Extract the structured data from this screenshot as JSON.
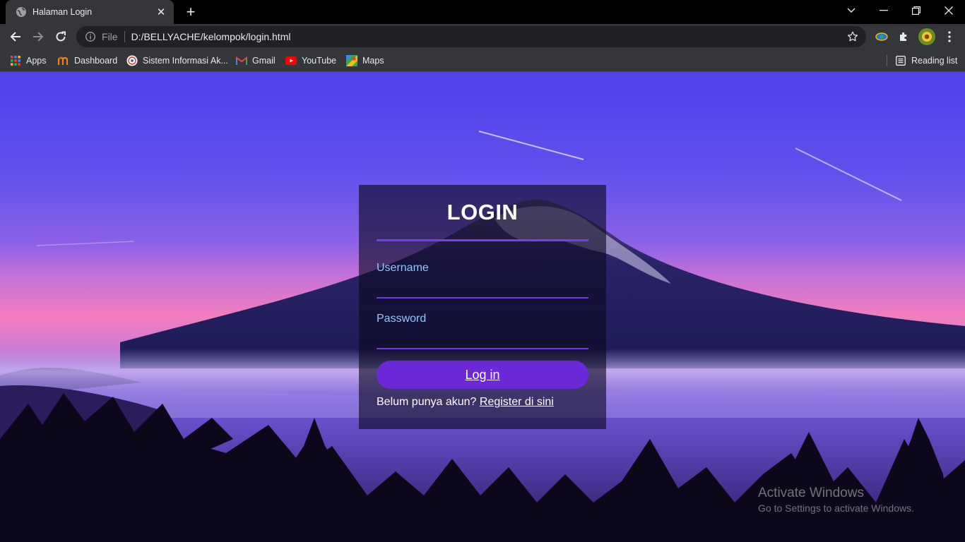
{
  "browser": {
    "tab": {
      "title": "Halaman Login",
      "favicon": "globe-icon"
    },
    "address": {
      "scheme_label": "File",
      "url": "D:/BELLYACHE/kelompok/login.html"
    },
    "bookmarks": [
      {
        "label": "Apps",
        "icon": "apps-grid-icon"
      },
      {
        "label": "Dashboard",
        "icon": "moodle-icon"
      },
      {
        "label": "Sistem Informasi Ak...",
        "icon": "university-icon"
      },
      {
        "label": "Gmail",
        "icon": "gmail-icon"
      },
      {
        "label": "YouTube",
        "icon": "youtube-icon"
      },
      {
        "label": "Maps",
        "icon": "maps-icon"
      }
    ],
    "reading_list": "Reading list"
  },
  "login": {
    "title": "LOGIN",
    "username_label": "Username",
    "username_value": "",
    "password_label": "Password",
    "password_value": "",
    "button_label": "Log in",
    "register_prompt": "Belum punya akun?",
    "register_link": "Register di sini"
  },
  "watermark": {
    "line1": "Activate Windows",
    "line2": "Go to Settings to activate Windows."
  },
  "colors": {
    "accent": "#6d28d9",
    "rule": "#7a3cf0",
    "label": "#8ec8ff",
    "chrome_dark": "#35363a"
  }
}
